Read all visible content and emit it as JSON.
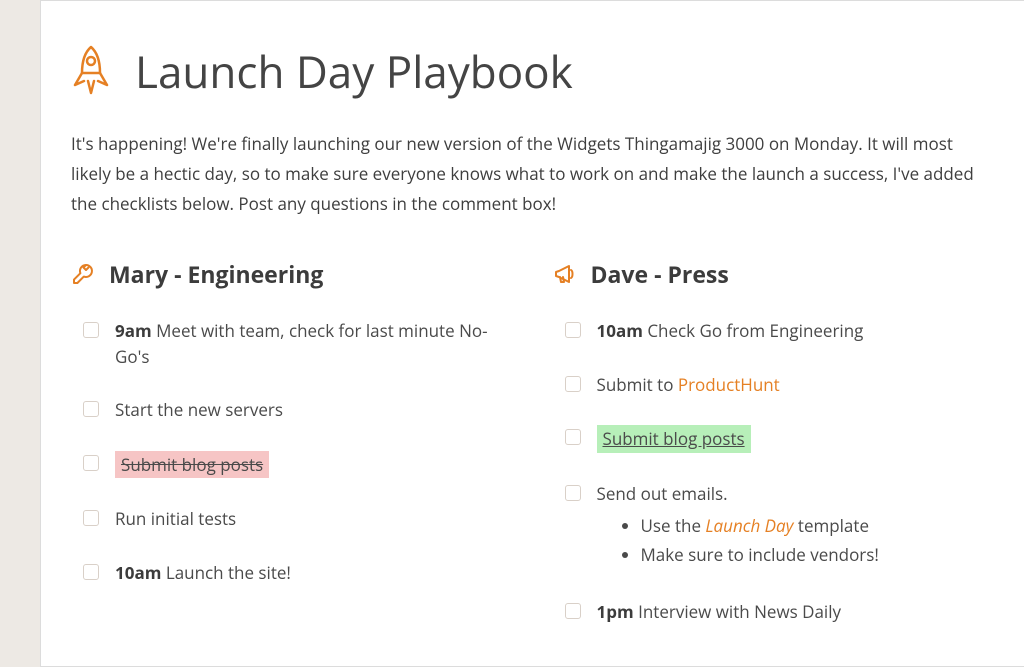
{
  "title": "Launch Day Playbook",
  "intro": "It's happening! We're finally launching our new version of the Widgets Thingamajig 3000 on Monday. It will most likely be a hectic day, so to make sure everyone knows what to work on and make the launch a success, I've added the checklists below. Post any questions in the comment box!",
  "columns": {
    "left": {
      "heading": "Mary - Engineering",
      "items": {
        "0": {
          "time": "9am",
          "text": "Meet with team, check for last minute No-Go's"
        },
        "1": {
          "text": "Start the new servers"
        },
        "2": {
          "text": "Submit blog posts"
        },
        "3": {
          "text": "Run initial tests"
        },
        "4": {
          "time": "10am",
          "text": "Launch the site!"
        }
      }
    },
    "right": {
      "heading": "Dave - Press",
      "items": {
        "0": {
          "time": "10am",
          "text": "Check Go from Engineering"
        },
        "1": {
          "prefix": "Submit to ",
          "link": "ProductHunt"
        },
        "2": {
          "text": "Submit blog posts"
        },
        "3": {
          "text": "Send out emails.",
          "sub": {
            "0": {
              "prefix": "Use the ",
              "em": "Launch Day",
              "suffix": " template"
            },
            "1": {
              "text": "Make sure to include vendors!"
            }
          }
        },
        "4": {
          "time": "1pm",
          "text": "Interview with News Daily"
        }
      }
    }
  }
}
